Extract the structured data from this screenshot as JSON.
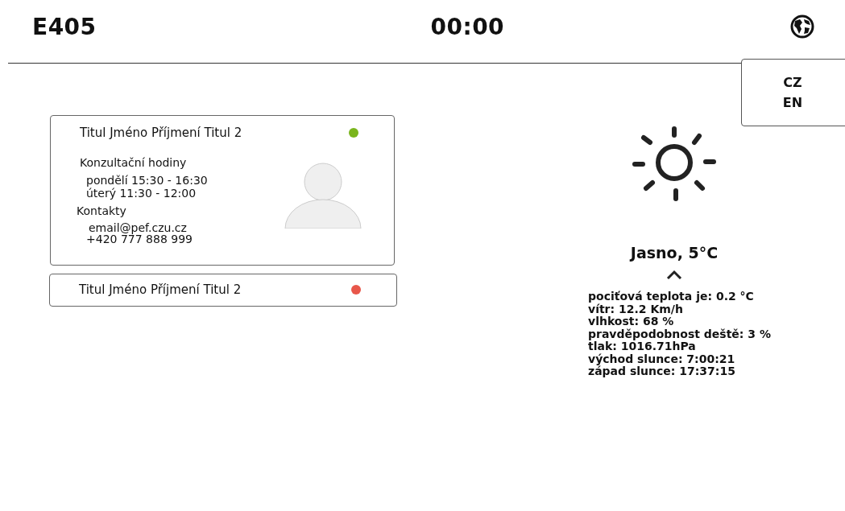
{
  "header": {
    "room": "E405",
    "time": "00:00"
  },
  "language_menu": {
    "expanded": true,
    "options": [
      {
        "label": "CZ"
      },
      {
        "label": "EN"
      }
    ]
  },
  "people": [
    {
      "name": "Titul Jméno Příjmení Titul 2",
      "color": "#7ab51d",
      "expanded": true,
      "hours_title": "Konzultační hodiny",
      "hours": [
        "pondělí 15:30 - 16:30",
        "úterý 11:30 - 12:00"
      ],
      "contacts_title": "Kontakty",
      "email": "email@pef.czu.cz",
      "phone": "+420 777 888 999"
    },
    {
      "name": "Titul Jméno Příjmení Titul 2",
      "color": "#e8574a",
      "expanded": false
    }
  ],
  "weather": {
    "summary": "Jasno, 5°C",
    "expanded": true,
    "details": [
      "pociťová teplota je: 0.2 °C",
      "vítr: 12.2 Km/h",
      "vlhkost: 68 %",
      "pravděpodobnost deště: 3 %",
      "tlak: 1016.71hPa",
      "východ slunce: 7:00:21",
      "západ slunce: 17:37:15"
    ]
  }
}
